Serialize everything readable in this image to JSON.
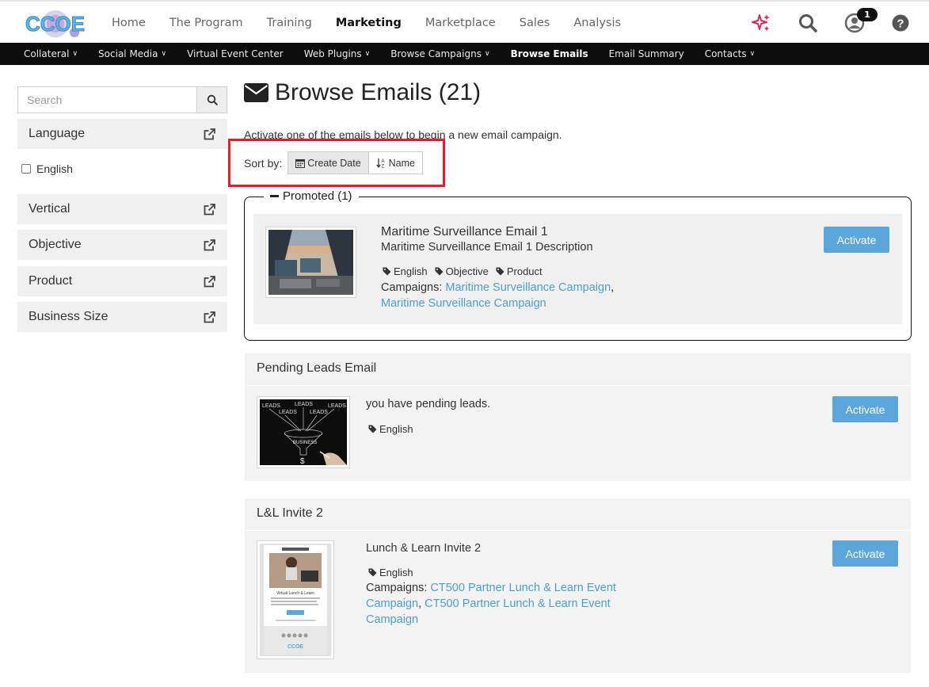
{
  "logo": {
    "text": "CCOE"
  },
  "topnav": {
    "items": [
      "Home",
      "The Program",
      "Training",
      "Marketing",
      "Marketplace",
      "Sales",
      "Analysis"
    ],
    "active": "Marketing",
    "notification_count": "1"
  },
  "subnav": {
    "items": [
      {
        "label": "Collateral",
        "dropdown": true
      },
      {
        "label": "Social Media",
        "dropdown": true
      },
      {
        "label": "Virtual Event Center",
        "dropdown": false
      },
      {
        "label": "Web Plugins",
        "dropdown": true
      },
      {
        "label": "Browse Campaigns",
        "dropdown": true
      },
      {
        "label": "Browse Emails",
        "dropdown": false,
        "active": true
      },
      {
        "label": "Email Summary",
        "dropdown": false
      },
      {
        "label": "Contacts",
        "dropdown": true
      }
    ]
  },
  "sidebar": {
    "search_placeholder": "Search",
    "facets": [
      "Language",
      "Vertical",
      "Objective",
      "Product",
      "Business Size"
    ],
    "language_option": "English"
  },
  "main": {
    "title": "Browse Emails (21)",
    "intro": "Activate one of the emails below to begin a new email campaign.",
    "sort_label": "Sort by:",
    "sort_create_date": "Create Date",
    "sort_name": "Name",
    "promoted_label": "Promoted (1)",
    "activate_label": "Activate"
  },
  "emails": [
    {
      "title": "Maritime Surveillance Email 1",
      "description": "Maritime Surveillance Email 1 Description",
      "tags": [
        "English",
        "Objective",
        "Product"
      ],
      "campaigns_label": "Campaigns:",
      "campaign_1": "Maritime Surveillance Campaign",
      "campaign_2": "Maritime Surveillance Campaign"
    },
    {
      "section_title": "Pending Leads Email",
      "description": "you have pending leads.",
      "tags": [
        "English"
      ],
      "thumb_words": [
        "LEADS",
        "LEADS",
        "LEADS",
        "LEADS",
        "LEADS",
        "BUSINESS",
        "$"
      ]
    },
    {
      "section_title": "L&L Invite 2",
      "description": "Lunch & Learn Invite 2",
      "tags": [
        "English"
      ],
      "campaigns_label": "Campaigns:",
      "campaign_1": "CT500 Partner Lunch & Learn Event Campaign",
      "campaign_2": "CT500 Partner Lunch & Learn Event Campaign",
      "thumb_words": [
        "Virtual Lunch & Learn"
      ]
    }
  ],
  "colors": {
    "accent": "#5ba7dc",
    "link": "#4a9fd5",
    "highlight": "#e0202b",
    "subnav_bg": "#0d0d0d"
  }
}
